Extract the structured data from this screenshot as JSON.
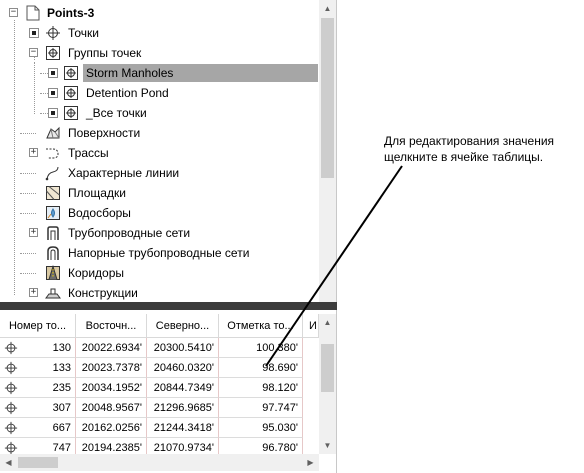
{
  "tree": {
    "root": {
      "label": "Points-3",
      "expander": "−",
      "icon": "document-icon"
    },
    "items": [
      {
        "id": "points",
        "label": "Точки",
        "expander": "+",
        "icon": "point-icon"
      },
      {
        "id": "point-groups",
        "label": "Группы точек",
        "expander": "−",
        "icon": "point-group-icon"
      },
      {
        "id": "storm-manholes",
        "label": "Storm Manholes",
        "icon": "point-group-icon",
        "selected": true
      },
      {
        "id": "detention-pond",
        "label": "Detention Pond",
        "icon": "point-group-icon"
      },
      {
        "id": "all-points",
        "label": "_Все точки",
        "icon": "point-group-icon"
      },
      {
        "id": "surfaces",
        "label": "Поверхности",
        "icon": "surface-icon"
      },
      {
        "id": "alignments",
        "label": "Трассы",
        "expander": "+",
        "icon": "alignment-icon"
      },
      {
        "id": "feature-lines",
        "label": "Характерные линии",
        "icon": "feature-line-icon"
      },
      {
        "id": "sites",
        "label": "Площадки",
        "icon": "site-icon"
      },
      {
        "id": "catchments",
        "label": "Водосборы",
        "icon": "catchment-icon"
      },
      {
        "id": "pipe-networks",
        "label": "Трубопроводные сети",
        "expander": "+",
        "icon": "pipe-network-icon"
      },
      {
        "id": "pressure-networks",
        "label": "Напорные трубопроводные сети",
        "icon": "pressure-network-icon"
      },
      {
        "id": "corridors",
        "label": "Коридоры",
        "icon": "corridor-icon"
      },
      {
        "id": "assemblies",
        "label": "Конструкции",
        "expander": "+",
        "icon": "assembly-icon"
      }
    ]
  },
  "table": {
    "headers": [
      "Номер то...",
      "Восточн...",
      "Северно...",
      "Отметка то...",
      "И"
    ],
    "rows": [
      {
        "number": "130",
        "easting": "20022.6934'",
        "northing": "20300.5410'",
        "elevation": "100.380'"
      },
      {
        "number": "133",
        "easting": "20023.7378'",
        "northing": "20460.0320'",
        "elevation": "98.690'"
      },
      {
        "number": "235",
        "easting": "20034.1952'",
        "northing": "20844.7349'",
        "elevation": "98.120'"
      },
      {
        "number": "307",
        "easting": "20048.9567'",
        "northing": "21296.9685'",
        "elevation": "97.747'"
      },
      {
        "number": "667",
        "easting": "20162.0256'",
        "northing": "21244.3418'",
        "elevation": "95.030'"
      },
      {
        "number": "747",
        "easting": "20194.2385'",
        "northing": "21070.9734'",
        "elevation": "96.780'"
      }
    ]
  },
  "callout": {
    "line1": "Для редактирования значения",
    "line2": "щелкните в ячейке таблицы."
  },
  "colors": {
    "selection": "#a6a6a6",
    "splitter": "#3c3c3c",
    "scroll_track": "#f0f0f0",
    "scroll_thumb": "#cdcdcd"
  }
}
